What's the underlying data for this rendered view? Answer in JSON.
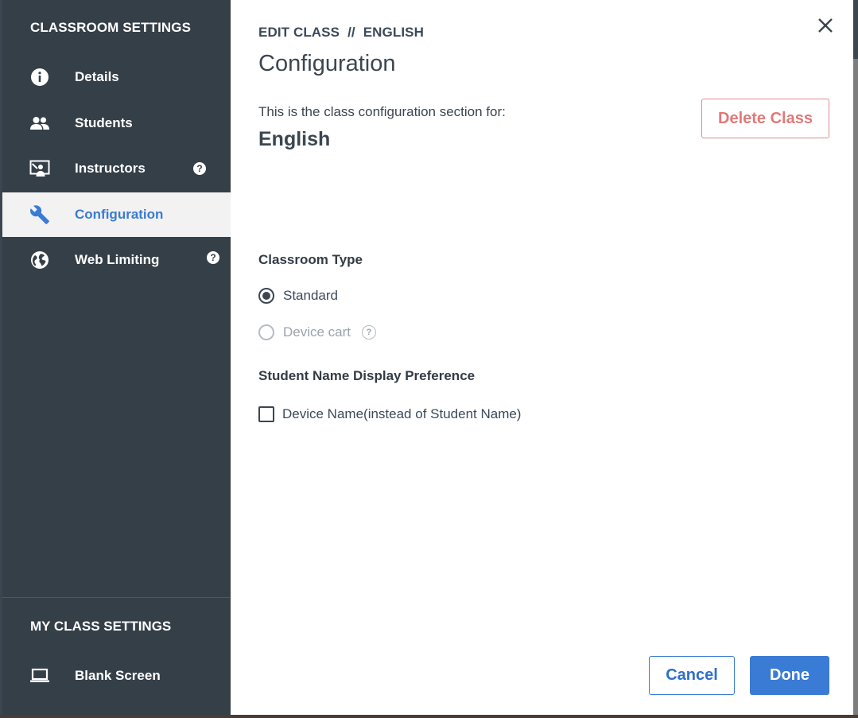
{
  "sidebar": {
    "heading": "CLASSROOM SETTINGS",
    "items": [
      {
        "label": "Details",
        "icon": "info-icon"
      },
      {
        "label": "Students",
        "icon": "people-icon"
      },
      {
        "label": "Instructors",
        "icon": "presenter-icon",
        "help": "?"
      },
      {
        "label": "Configuration",
        "icon": "wrench-icon",
        "active": true
      },
      {
        "label": "Web Limiting",
        "icon": "globe-icon",
        "help": "?"
      }
    ],
    "my_heading": "MY CLASS SETTINGS",
    "my_items": [
      {
        "label": "Blank Screen",
        "icon": "laptop-icon"
      }
    ]
  },
  "breadcrumb": {
    "part1": "EDIT CLASS",
    "separator": "//",
    "part2": "ENGLISH"
  },
  "page_title": "Configuration",
  "intro_text": "This is the class configuration section for:",
  "class_name": "English",
  "delete_label": "Delete Class",
  "classroom_type": {
    "label": "Classroom Type",
    "options": [
      {
        "label": "Standard",
        "selected": true,
        "disabled": false
      },
      {
        "label": "Device cart",
        "selected": false,
        "disabled": true,
        "help": "?"
      }
    ]
  },
  "name_display": {
    "label": "Student Name Display Preference",
    "checkbox_label": "Device Name(instead of Student Name)",
    "checked": false
  },
  "footer": {
    "cancel_label": "Cancel",
    "done_label": "Done"
  },
  "colors": {
    "sidebar_bg": "#353f48",
    "accent": "#3a7bd5",
    "danger": "#e07a78"
  }
}
